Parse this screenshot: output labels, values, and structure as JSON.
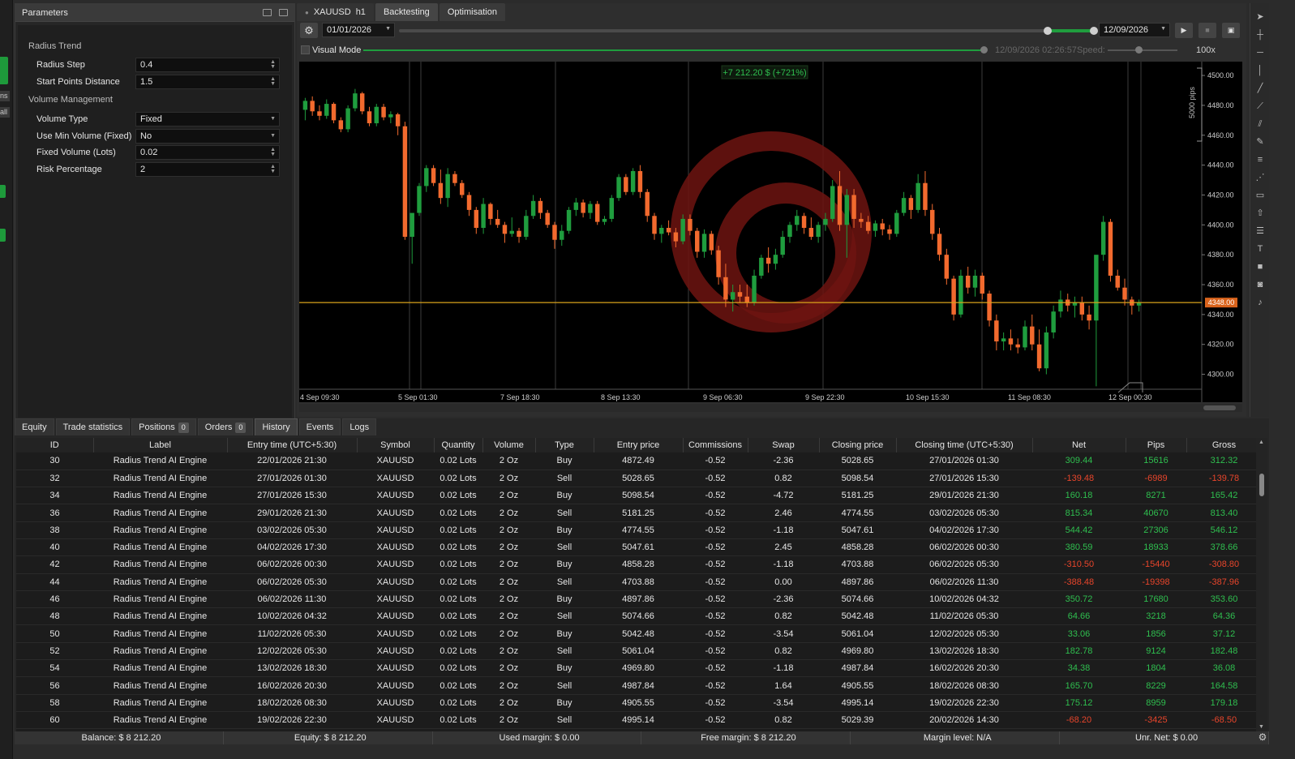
{
  "left_strip": {
    "chips": [
      "ns",
      "all"
    ]
  },
  "params": {
    "title": "Parameters",
    "sections": [
      {
        "label": "Radius Trend",
        "rows": [
          {
            "label": "Radius Step",
            "value": "0.4",
            "control": "spin"
          },
          {
            "label": "Start Points Distance",
            "value": "1.5",
            "control": "spin"
          }
        ]
      },
      {
        "label": "Volume Management",
        "rows": [
          {
            "label": "Volume Type",
            "value": "Fixed",
            "control": "select"
          },
          {
            "label": "Use Min Volume (Fixed)",
            "value": "No",
            "control": "select"
          },
          {
            "label": "Fixed Volume (Lots)",
            "value": "0.02",
            "control": "spin"
          },
          {
            "label": "Risk Percentage",
            "value": "2",
            "control": "spin"
          }
        ]
      }
    ]
  },
  "top_tabs": {
    "symbol": "XAUUSD",
    "timeframe": "h1",
    "backtesting": "Backtesting",
    "optimisation": "Optimisation"
  },
  "toolbar": {
    "start_date": "01/01/2026",
    "end_date": "12/09/2026",
    "gear_icon": "gear-icon",
    "play_icon": "play-icon",
    "stop_icon": "stop-icon",
    "save_icon": "save-icon"
  },
  "visual_mode": {
    "label": "Visual Mode",
    "time": "12/09/2026 02:26:57",
    "speed_label": "Speed:",
    "speed_value": "100x"
  },
  "chart_data": {
    "type": "candlestick",
    "profit_label": "+7 212.20 $ (+721%)",
    "pips_label": "5000 pips",
    "current_price": "4348.00",
    "y_ticks": [
      "4500.00",
      "4480.00",
      "4460.00",
      "4440.00",
      "4420.00",
      "4400.00",
      "4380.00",
      "4360.00",
      "4340.00",
      "4320.00",
      "4300.00"
    ],
    "ylim": [
      4290,
      4506
    ],
    "x_ticks": [
      "4 Sep 09:30",
      "5 Sep 01:30",
      "7 Sep 18:30",
      "8 Sep 13:30",
      "9 Sep 06:30",
      "9 Sep 22:30",
      "10 Sep 15:30",
      "11 Sep 08:30",
      "12 Sep 00:30"
    ],
    "up_color": "#1f9d3e",
    "down_color": "#f26a2e",
    "price_line_color": "#d9a21b",
    "ohlc": [
      [
        4477,
        4485,
        4470,
        4483
      ],
      [
        4483,
        4486,
        4473,
        4476
      ],
      [
        4476,
        4480,
        4470,
        4473
      ],
      [
        4473,
        4484,
        4471,
        4481
      ],
      [
        4481,
        4482,
        4468,
        4470
      ],
      [
        4470,
        4472,
        4462,
        4464
      ],
      [
        4464,
        4480,
        4462,
        4478
      ],
      [
        4478,
        4491,
        4476,
        4488
      ],
      [
        4488,
        4489,
        4474,
        4476
      ],
      [
        4476,
        4479,
        4466,
        4468
      ],
      [
        4468,
        4481,
        4466,
        4479
      ],
      [
        4479,
        4481,
        4470,
        4472
      ],
      [
        4472,
        4476,
        4468,
        4474
      ],
      [
        4474,
        4475,
        4460,
        4466
      ],
      [
        4466,
        4469,
        4390,
        4392
      ],
      [
        4392,
        4395,
        4374,
        4408
      ],
      [
        4408,
        4428,
        4406,
        4426
      ],
      [
        4426,
        4440,
        4422,
        4438
      ],
      [
        4438,
        4440,
        4426,
        4428
      ],
      [
        4428,
        4437,
        4414,
        4418
      ],
      [
        4418,
        4438,
        4412,
        4434
      ],
      [
        4434,
        4436,
        4426,
        4428
      ],
      [
        4428,
        4430,
        4418,
        4420
      ],
      [
        4420,
        4422,
        4406,
        4410
      ],
      [
        4410,
        4412,
        4394,
        4398
      ],
      [
        4398,
        4418,
        4394,
        4414
      ],
      [
        4414,
        4415,
        4400,
        4404
      ],
      [
        4404,
        4410,
        4398,
        4400
      ],
      [
        4400,
        4402,
        4388,
        4394
      ],
      [
        4394,
        4405,
        4392,
        4396
      ],
      [
        4396,
        4398,
        4388,
        4392
      ],
      [
        4392,
        4410,
        4390,
        4406
      ],
      [
        4406,
        4420,
        4404,
        4416
      ],
      [
        4416,
        4418,
        4404,
        4408
      ],
      [
        4408,
        4410,
        4398,
        4400
      ],
      [
        4400,
        4402,
        4384,
        4390
      ],
      [
        4390,
        4400,
        4386,
        4396
      ],
      [
        4396,
        4412,
        4394,
        4410
      ],
      [
        4410,
        4418,
        4406,
        4415
      ],
      [
        4415,
        4417,
        4405,
        4408
      ],
      [
        4408,
        4416,
        4404,
        4414
      ],
      [
        4414,
        4416,
        4400,
        4402
      ],
      [
        4402,
        4406,
        4400,
        4404
      ],
      [
        4404,
        4420,
        4402,
        4418
      ],
      [
        4418,
        4434,
        4416,
        4432
      ],
      [
        4432,
        4434,
        4420,
        4422
      ],
      [
        4422,
        4438,
        4420,
        4436
      ],
      [
        4436,
        4440,
        4418,
        4422
      ],
      [
        4422,
        4424,
        4402,
        4406
      ],
      [
        4406,
        4408,
        4390,
        4394
      ],
      [
        4394,
        4400,
        4388,
        4398
      ],
      [
        4398,
        4403,
        4393,
        4395
      ],
      [
        4395,
        4398,
        4385,
        4389
      ],
      [
        4389,
        4407,
        4387,
        4404
      ],
      [
        4404,
        4407,
        4393,
        4396
      ],
      [
        4396,
        4398,
        4378,
        4382
      ],
      [
        4382,
        4397,
        4378,
        4394
      ],
      [
        4394,
        4396,
        4380,
        4383
      ],
      [
        4383,
        4386,
        4360,
        4365
      ],
      [
        4365,
        4374,
        4345,
        4350
      ],
      [
        4350,
        4360,
        4342,
        4355
      ],
      [
        4355,
        4360,
        4348,
        4352
      ],
      [
        4352,
        4360,
        4345,
        4348
      ],
      [
        4348,
        4370,
        4346,
        4366
      ],
      [
        4366,
        4380,
        4364,
        4378
      ],
      [
        4378,
        4385,
        4368,
        4374
      ],
      [
        4374,
        4384,
        4370,
        4380
      ],
      [
        4380,
        4396,
        4378,
        4392
      ],
      [
        4392,
        4402,
        4388,
        4400
      ],
      [
        4400,
        4410,
        4396,
        4406
      ],
      [
        4406,
        4408,
        4394,
        4398
      ],
      [
        4398,
        4405,
        4390,
        4392
      ],
      [
        4392,
        4402,
        4388,
        4400
      ],
      [
        4400,
        4408,
        4396,
        4404
      ],
      [
        4404,
        4430,
        4402,
        4426
      ],
      [
        4426,
        4436,
        4396,
        4400
      ],
      [
        4400,
        4424,
        4378,
        4420
      ],
      [
        4420,
        4424,
        4398,
        4404
      ],
      [
        4404,
        4408,
        4398,
        4402
      ],
      [
        4402,
        4406,
        4394,
        4396
      ],
      [
        4396,
        4403,
        4392,
        4401
      ],
      [
        4401,
        4404,
        4393,
        4397
      ],
      [
        4397,
        4400,
        4390,
        4394
      ],
      [
        4394,
        4410,
        4392,
        4408
      ],
      [
        4408,
        4422,
        4406,
        4418
      ],
      [
        4418,
        4420,
        4404,
        4410
      ],
      [
        4410,
        4434,
        4408,
        4428
      ],
      [
        4428,
        4436,
        4406,
        4410
      ],
      [
        4410,
        4414,
        4390,
        4394
      ],
      [
        4394,
        4398,
        4376,
        4380
      ],
      [
        4380,
        4384,
        4360,
        4364
      ],
      [
        4364,
        4366,
        4336,
        4340
      ],
      [
        4340,
        4370,
        4338,
        4366
      ],
      [
        4366,
        4372,
        4354,
        4358
      ],
      [
        4358,
        4370,
        4352,
        4366
      ],
      [
        4366,
        4368,
        4350,
        4354
      ],
      [
        4354,
        4356,
        4332,
        4336
      ],
      [
        4336,
        4340,
        4316,
        4322
      ],
      [
        4322,
        4328,
        4316,
        4324
      ],
      [
        4324,
        4330,
        4316,
        4320
      ],
      [
        4320,
        4324,
        4314,
        4318
      ],
      [
        4318,
        4336,
        4316,
        4332
      ],
      [
        4332,
        4340,
        4316,
        4320
      ],
      [
        4320,
        4330,
        4302,
        4304
      ],
      [
        4304,
        4332,
        4300,
        4328
      ],
      [
        4328,
        4346,
        4324,
        4342
      ],
      [
        4342,
        4356,
        4338,
        4350
      ],
      [
        4350,
        4354,
        4342,
        4346
      ],
      [
        4346,
        4352,
        4338,
        4348
      ],
      [
        4348,
        4352,
        4336,
        4340
      ],
      [
        4340,
        4346,
        4330,
        4336
      ],
      [
        4336,
        4376,
        4292,
        4380
      ],
      [
        4380,
        4406,
        4376,
        4402
      ],
      [
        4402,
        4404,
        4362,
        4366
      ],
      [
        4366,
        4370,
        4356,
        4358
      ],
      [
        4358,
        4364,
        4346,
        4350
      ],
      [
        4350,
        4352,
        4340,
        4346
      ],
      [
        4346,
        4350,
        4342,
        4348
      ]
    ]
  },
  "bottom_tabs": [
    {
      "label": "Equity"
    },
    {
      "label": "Trade statistics"
    },
    {
      "label": "Positions",
      "badge": "0"
    },
    {
      "label": "Orders",
      "badge": "0"
    },
    {
      "label": "History"
    },
    {
      "label": "Events"
    },
    {
      "label": "Logs"
    }
  ],
  "history": {
    "columns": [
      "ID",
      "Label",
      "Entry time (UTC+5:30)",
      "Symbol",
      "Quantity",
      "Volume",
      "Type",
      "Entry price",
      "Commissions",
      "Swap",
      "Closing price",
      "Closing time (UTC+5:30)",
      "Net",
      "Pips",
      "Gross"
    ],
    "rows": [
      [
        "30",
        "Radius Trend AI Engine",
        "22/01/2026 21:30",
        "XAUUSD",
        "0.02 Lots",
        "2 Oz",
        "Buy",
        "4872.49",
        "-0.52",
        "-2.36",
        "5028.65",
        "27/01/2026 01:30",
        "309.44",
        "15616",
        "312.32"
      ],
      [
        "32",
        "Radius Trend AI Engine",
        "27/01/2026 01:30",
        "XAUUSD",
        "0.02 Lots",
        "2 Oz",
        "Sell",
        "5028.65",
        "-0.52",
        "0.82",
        "5098.54",
        "27/01/2026 15:30",
        "-139.48",
        "-6989",
        "-139.78"
      ],
      [
        "34",
        "Radius Trend AI Engine",
        "27/01/2026 15:30",
        "XAUUSD",
        "0.02 Lots",
        "2 Oz",
        "Buy",
        "5098.54",
        "-0.52",
        "-4.72",
        "5181.25",
        "29/01/2026 21:30",
        "160.18",
        "8271",
        "165.42"
      ],
      [
        "36",
        "Radius Trend AI Engine",
        "29/01/2026 21:30",
        "XAUUSD",
        "0.02 Lots",
        "2 Oz",
        "Sell",
        "5181.25",
        "-0.52",
        "2.46",
        "4774.55",
        "03/02/2026 05:30",
        "815.34",
        "40670",
        "813.40"
      ],
      [
        "38",
        "Radius Trend AI Engine",
        "03/02/2026 05:30",
        "XAUUSD",
        "0.02 Lots",
        "2 Oz",
        "Buy",
        "4774.55",
        "-0.52",
        "-1.18",
        "5047.61",
        "04/02/2026 17:30",
        "544.42",
        "27306",
        "546.12"
      ],
      [
        "40",
        "Radius Trend AI Engine",
        "04/02/2026 17:30",
        "XAUUSD",
        "0.02 Lots",
        "2 Oz",
        "Sell",
        "5047.61",
        "-0.52",
        "2.45",
        "4858.28",
        "06/02/2026 00:30",
        "380.59",
        "18933",
        "378.66"
      ],
      [
        "42",
        "Radius Trend AI Engine",
        "06/02/2026 00:30",
        "XAUUSD",
        "0.02 Lots",
        "2 Oz",
        "Buy",
        "4858.28",
        "-0.52",
        "-1.18",
        "4703.88",
        "06/02/2026 05:30",
        "-310.50",
        "-15440",
        "-308.80"
      ],
      [
        "44",
        "Radius Trend AI Engine",
        "06/02/2026 05:30",
        "XAUUSD",
        "0.02 Lots",
        "2 Oz",
        "Sell",
        "4703.88",
        "-0.52",
        "0.00",
        "4897.86",
        "06/02/2026 11:30",
        "-388.48",
        "-19398",
        "-387.96"
      ],
      [
        "46",
        "Radius Trend AI Engine",
        "06/02/2026 11:30",
        "XAUUSD",
        "0.02 Lots",
        "2 Oz",
        "Buy",
        "4897.86",
        "-0.52",
        "-2.36",
        "5074.66",
        "10/02/2026 04:32",
        "350.72",
        "17680",
        "353.60"
      ],
      [
        "48",
        "Radius Trend AI Engine",
        "10/02/2026 04:32",
        "XAUUSD",
        "0.02 Lots",
        "2 Oz",
        "Sell",
        "5074.66",
        "-0.52",
        "0.82",
        "5042.48",
        "11/02/2026 05:30",
        "64.66",
        "3218",
        "64.36"
      ],
      [
        "50",
        "Radius Trend AI Engine",
        "11/02/2026 05:30",
        "XAUUSD",
        "0.02 Lots",
        "2 Oz",
        "Buy",
        "5042.48",
        "-0.52",
        "-3.54",
        "5061.04",
        "12/02/2026 05:30",
        "33.06",
        "1856",
        "37.12"
      ],
      [
        "52",
        "Radius Trend AI Engine",
        "12/02/2026 05:30",
        "XAUUSD",
        "0.02 Lots",
        "2 Oz",
        "Sell",
        "5061.04",
        "-0.52",
        "0.82",
        "4969.80",
        "13/02/2026 18:30",
        "182.78",
        "9124",
        "182.48"
      ],
      [
        "54",
        "Radius Trend AI Engine",
        "13/02/2026 18:30",
        "XAUUSD",
        "0.02 Lots",
        "2 Oz",
        "Buy",
        "4969.80",
        "-0.52",
        "-1.18",
        "4987.84",
        "16/02/2026 20:30",
        "34.38",
        "1804",
        "36.08"
      ],
      [
        "56",
        "Radius Trend AI Engine",
        "16/02/2026 20:30",
        "XAUUSD",
        "0.02 Lots",
        "2 Oz",
        "Sell",
        "4987.84",
        "-0.52",
        "1.64",
        "4905.55",
        "18/02/2026 08:30",
        "165.70",
        "8229",
        "164.58"
      ],
      [
        "58",
        "Radius Trend AI Engine",
        "18/02/2026 08:30",
        "XAUUSD",
        "0.02 Lots",
        "2 Oz",
        "Buy",
        "4905.55",
        "-0.52",
        "-3.54",
        "4995.14",
        "19/02/2026 22:30",
        "175.12",
        "8959",
        "179.18"
      ],
      [
        "60",
        "Radius Trend AI Engine",
        "19/02/2026 22:30",
        "XAUUSD",
        "0.02 Lots",
        "2 Oz",
        "Sell",
        "4995.14",
        "-0.52",
        "0.82",
        "5029.39",
        "20/02/2026 14:30",
        "-68.20",
        "-3425",
        "-68.50"
      ]
    ]
  },
  "status": {
    "balance": "Balance: $ 8 212.20",
    "equity": "Equity: $ 8 212.20",
    "used_margin": "Used margin: $ 0.00",
    "free_margin": "Free margin: $ 8 212.20",
    "margin_level": "Margin level: N/A",
    "unr_net": "Unr. Net: $ 0.00"
  }
}
